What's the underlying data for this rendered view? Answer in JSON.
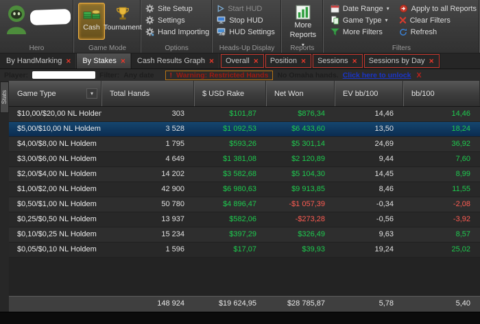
{
  "ribbon": {
    "hero": {
      "label": "Hero"
    },
    "game_mode": {
      "label": "Game Mode",
      "cash_label": "Cash",
      "tournament_label": "Tournament"
    },
    "options": {
      "label": "Options",
      "items": [
        "Site Setup",
        "Settings",
        "Hand Importing"
      ]
    },
    "hud": {
      "label": "Heads-Up Display",
      "items": [
        "Start HUD",
        "Stop HUD",
        "HUD Settings"
      ]
    },
    "reports": {
      "label": "Reports",
      "more_reports_label": "More Reports"
    },
    "filters": {
      "label": "Filters",
      "date_range": "Date Range",
      "game_type": "Game Type",
      "more_filters": "More Filters",
      "apply_all": "Apply to all Reports",
      "clear_filters": "Clear Filters",
      "refresh": "Refresh"
    }
  },
  "tabs": [
    {
      "label": "By HandMarking",
      "active": false,
      "boxed": false
    },
    {
      "label": "By Stakes",
      "active": true,
      "boxed": false
    },
    {
      "label": "Cash Results Graph",
      "active": false,
      "boxed": false
    },
    {
      "label": "Overall",
      "active": false,
      "boxed": true
    },
    {
      "label": "Position",
      "active": false,
      "boxed": true
    },
    {
      "label": "Sessions",
      "active": false,
      "boxed": true
    },
    {
      "label": "Sessions by Day",
      "active": false,
      "boxed": true
    }
  ],
  "filter_bar": {
    "player_label": "Player:",
    "filter_label": "Filter:",
    "filter_value": "Any date",
    "warning_bang": "!",
    "warning_text": "Warning: Restricted Hands",
    "warning_detail": "No Omaha hands.",
    "unlock_link": "Click here to unlock",
    "close_label": "X"
  },
  "side_tab_label": "Stats",
  "table": {
    "columns": [
      "Game Type",
      "Total Hands",
      "$ USD Rake",
      "Net Won",
      "EV bb/100",
      "bb/100"
    ],
    "rows": [
      {
        "game": "$10,00/$20,00 NL Holdem",
        "hands": "303",
        "rake": "$101,87",
        "net": "$876,34",
        "ev": "14,46",
        "bb": "14,46",
        "selected": false
      },
      {
        "game": "$5,00/$10,00 NL Holdem",
        "hands": "3 528",
        "rake": "$1 092,53",
        "net": "$6 433,60",
        "ev": "13,50",
        "bb": "18,24",
        "selected": true
      },
      {
        "game": "$4,00/$8,00 NL Holdem",
        "hands": "1 795",
        "rake": "$593,26",
        "net": "$5 301,14",
        "ev": "24,69",
        "bb": "36,92",
        "selected": false
      },
      {
        "game": "$3,00/$6,00 NL Holdem",
        "hands": "4 649",
        "rake": "$1 381,08",
        "net": "$2 120,89",
        "ev": "9,44",
        "bb": "7,60",
        "selected": false
      },
      {
        "game": "$2,00/$4,00 NL Holdem",
        "hands": "14 202",
        "rake": "$3 582,68",
        "net": "$5 104,30",
        "ev": "14,45",
        "bb": "8,99",
        "selected": false
      },
      {
        "game": "$1,00/$2,00 NL Holdem",
        "hands": "42 900",
        "rake": "$6 980,63",
        "net": "$9 913,85",
        "ev": "8,46",
        "bb": "11,55",
        "selected": false
      },
      {
        "game": "$0,50/$1,00 NL Holdem",
        "hands": "50 780",
        "rake": "$4 896,47",
        "net": "-$1 057,39",
        "ev": "-0,34",
        "bb": "-2,08",
        "selected": false
      },
      {
        "game": "$0,25/$0,50 NL Holdem",
        "hands": "13 937",
        "rake": "$582,06",
        "net": "-$273,28",
        "ev": "-0,56",
        "bb": "-3,92",
        "selected": false
      },
      {
        "game": "$0,10/$0,25 NL Holdem",
        "hands": "15 234",
        "rake": "$397,29",
        "net": "$326,49",
        "ev": "9,63",
        "bb": "8,57",
        "selected": false
      },
      {
        "game": "$0,05/$0,10 NL Holdem",
        "hands": "1 596",
        "rake": "$17,07",
        "net": "$39,93",
        "ev": "19,24",
        "bb": "25,02",
        "selected": false
      }
    ],
    "totals": {
      "hands": "148 924",
      "rake": "$19 624,95",
      "net": "$28 785,87",
      "ev": "5,78",
      "bb": "5,40"
    }
  },
  "colors": {
    "positive": "#1ecb4f",
    "negative": "#ff5c52",
    "selected_row": "#0d3a66",
    "accent_orange": "#f59b22",
    "alert_red": "#c8372d"
  }
}
